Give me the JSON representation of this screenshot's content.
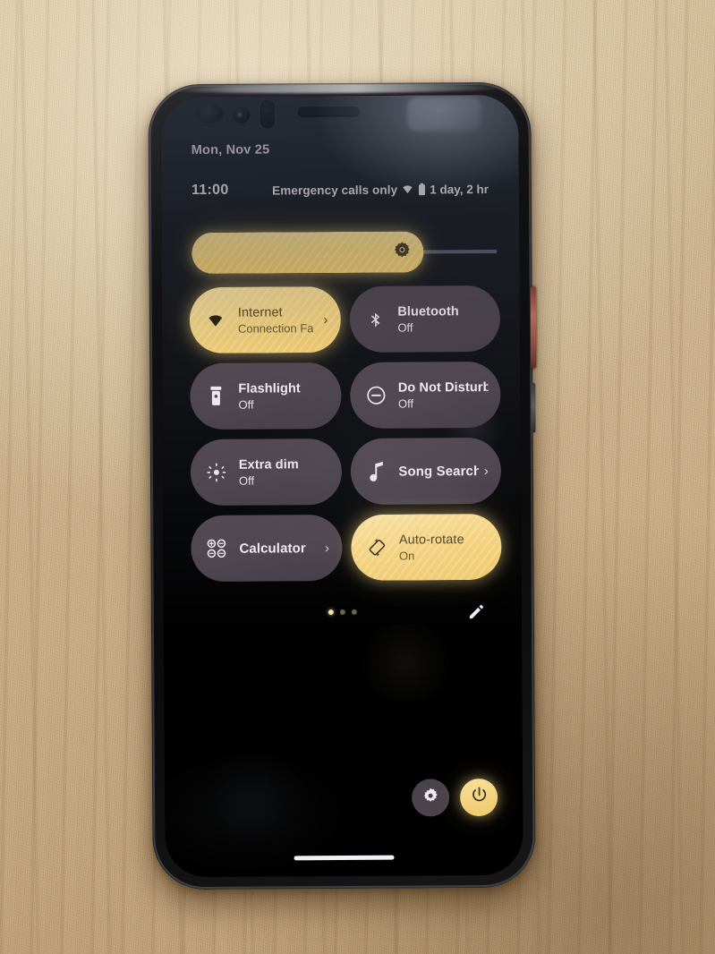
{
  "scene": {
    "description": "photo-of-phone-on-wooden-desk",
    "desk_color": "#c8ae86",
    "phone_body_color": "#121214"
  },
  "theme": {
    "accent_on": "#f3d37f",
    "tile_off": "#4e4650",
    "panel_bg": "#22262e",
    "text_primary": "#f0e9f0",
    "text_on_accent": "#55472a"
  },
  "status_bar": {
    "date": "Mon, Nov 25",
    "time": "11:00",
    "carrier": "Emergency calls only",
    "wifi_icon": "wifi-icon",
    "battery_icon": "battery-icon",
    "battery_estimate": "1 day, 2 hr"
  },
  "brightness": {
    "label": "Brightness",
    "value_percent": 76,
    "icon": "brightness-icon"
  },
  "tiles": [
    {
      "name": "internet",
      "title": "Internet",
      "subtitle": "Connection Fa",
      "state": "on",
      "icon": "wifi-icon",
      "has_chevron": true
    },
    {
      "name": "bluetooth",
      "title": "Bluetooth",
      "subtitle": "Off",
      "state": "off",
      "icon": "bluetooth-icon",
      "has_chevron": false
    },
    {
      "name": "flashlight",
      "title": "Flashlight",
      "subtitle": "Off",
      "state": "off",
      "icon": "flashlight-icon",
      "has_chevron": false
    },
    {
      "name": "do-not-disturb",
      "title": "Do Not Disturb",
      "subtitle": "Off",
      "state": "off",
      "icon": "do-not-disturb-icon",
      "has_chevron": false
    },
    {
      "name": "extra-dim",
      "title": "Extra dim",
      "subtitle": "Off",
      "state": "off",
      "icon": "extra-dim-icon",
      "has_chevron": false
    },
    {
      "name": "song-search",
      "title": "Song Search",
      "subtitle": "",
      "state": "off",
      "icon": "music-note-icon",
      "has_chevron": true
    },
    {
      "name": "calculator",
      "title": "Calculator",
      "subtitle": "",
      "state": "off",
      "icon": "calculator-icon",
      "has_chevron": true
    },
    {
      "name": "auto-rotate",
      "title": "Auto-rotate",
      "subtitle": "On",
      "state": "on",
      "icon": "auto-rotate-icon",
      "has_chevron": false
    }
  ],
  "footer": {
    "pages": 3,
    "active_page": 1,
    "edit_icon": "edit-pencil-icon",
    "settings_icon": "gear-icon",
    "power_icon": "power-icon"
  }
}
